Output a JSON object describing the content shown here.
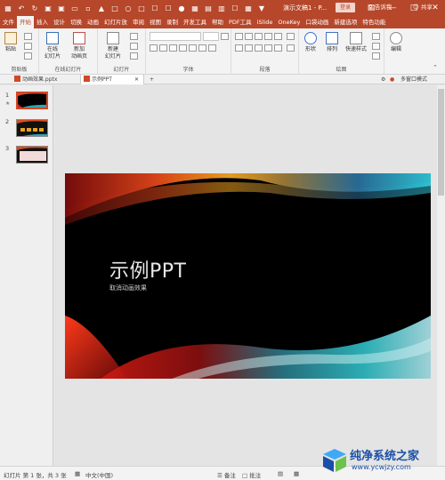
{
  "titlebar": {
    "title": "演示文稿1 - P...",
    "login": "登录",
    "quick_access": [
      "save-icon",
      "undo-icon",
      "redo-icon",
      "start-presentation-icon"
    ],
    "colors": {
      "accent": "#b7472a"
    }
  },
  "ribbon_tabs": [
    "文件",
    "开始",
    "插入",
    "设计",
    "切换",
    "动画",
    "幻灯片放",
    "审阅",
    "视图",
    "录制",
    "开发工具",
    "帮助",
    "PDF工具",
    "iSlide",
    "OneKey",
    "口袋动画",
    "新建选项",
    "特色功能"
  ],
  "active_tab": "开始",
  "tell_me": "告诉我",
  "share": "共享",
  "ribbon_groups": {
    "clipboard": {
      "label": "剪贴板",
      "paste": "粘贴"
    },
    "online_slides": {
      "label": "在线幻灯片",
      "online_slide_btn": "在线\n幻灯片",
      "new_anim_btn": "新加\n动画页"
    },
    "slides": {
      "label": "幻灯片",
      "new_slide": "新建\n幻灯片"
    },
    "font": {
      "label": "字体"
    },
    "paragraph": {
      "label": "段落"
    },
    "drawing": {
      "label": "绘图",
      "shapes": "形状",
      "arrange": "排列",
      "quick_styles": "快速样式"
    },
    "editing": {
      "label": "",
      "edit": "编辑"
    }
  },
  "doc_tabs": [
    {
      "name": "动画效果.pptx",
      "active": false
    },
    {
      "name": "示例PPT",
      "active": true
    }
  ],
  "multi_window": "多窗口模式",
  "slides": [
    {
      "num": "1",
      "selected": true
    },
    {
      "num": "2",
      "selected": false
    },
    {
      "num": "3",
      "selected": false
    }
  ],
  "slide": {
    "title": "示例PPT",
    "subtitle": "取消动画效果"
  },
  "statusbar": {
    "slide_info": "幻灯片 第 1 张，共 3 张",
    "language": "中文(中国)",
    "notes": "备注",
    "comments": "批注"
  },
  "watermark": {
    "text": "纯净系统之家",
    "url": "www.ycwjzy.com"
  }
}
